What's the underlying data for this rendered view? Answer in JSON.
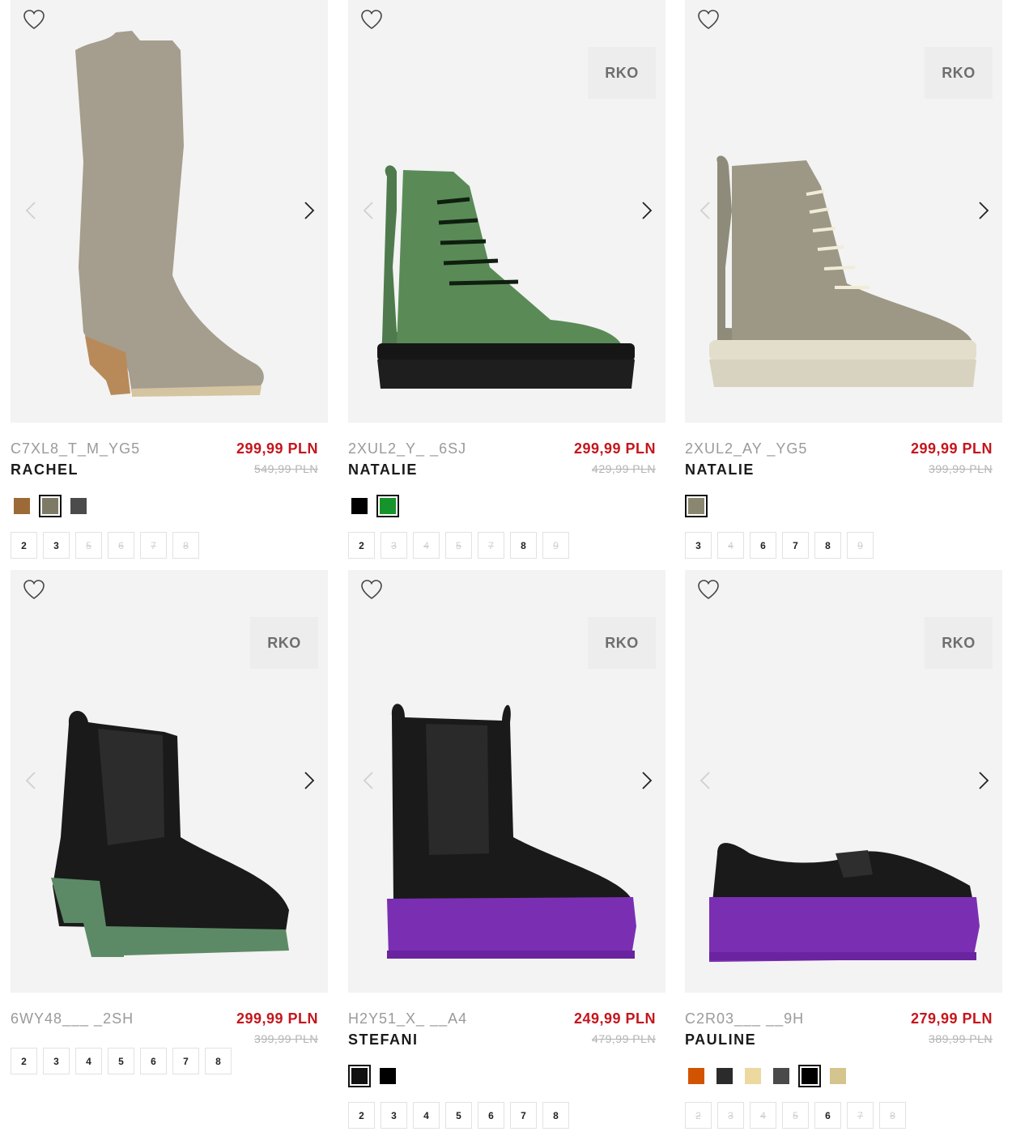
{
  "colors": {
    "price_red": "#c4161c",
    "text_dark": "#1a1a1a",
    "muted": "#9a9a9a",
    "tile_bg": "#f3f3f3"
  },
  "icons": {
    "wishlist": "heart-outline-icon",
    "prev": "chevron-left-icon",
    "next": "chevron-right-icon"
  },
  "products": [
    {
      "sku": "C7XL8_T_M_YG5",
      "name": "RACHEL",
      "price": "299,99 PLN",
      "old_price": "549,99 PLN",
      "brand": "",
      "swatches": [
        {
          "color": "#9c6a36",
          "selected": false
        },
        {
          "color": "#7d7a66",
          "selected": true
        },
        {
          "color": "#4b4b4b",
          "selected": false
        }
      ],
      "sizes": [
        {
          "label": "2",
          "available": true
        },
        {
          "label": "3",
          "available": true
        },
        {
          "label": "5",
          "available": false
        },
        {
          "label": "6",
          "available": false
        },
        {
          "label": "7",
          "available": false
        },
        {
          "label": "8",
          "available": false
        }
      ]
    },
    {
      "sku": "2XUL2_Y_ _6SJ",
      "name": "NATALIE",
      "price": "299,99 PLN",
      "old_price": "429,99 PLN",
      "brand": "RKO",
      "swatches": [
        {
          "color": "#000000",
          "selected": false
        },
        {
          "color": "#16932a",
          "selected": true
        }
      ],
      "sizes": [
        {
          "label": "2",
          "available": true
        },
        {
          "label": "3",
          "available": false
        },
        {
          "label": "4",
          "available": false
        },
        {
          "label": "5",
          "available": false
        },
        {
          "label": "7",
          "available": false
        },
        {
          "label": "8",
          "available": true
        },
        {
          "label": "9",
          "available": false
        }
      ]
    },
    {
      "sku": "2XUL2_AY _YG5",
      "name": "NATALIE",
      "price": "299,99 PLN",
      "old_price": "399,99 PLN",
      "brand": "RKO",
      "swatches": [
        {
          "color": "#8a8670",
          "selected": true
        }
      ],
      "sizes": [
        {
          "label": "3",
          "available": true
        },
        {
          "label": "4",
          "available": false
        },
        {
          "label": "6",
          "available": true
        },
        {
          "label": "7",
          "available": true
        },
        {
          "label": "8",
          "available": true
        },
        {
          "label": "9",
          "available": false
        }
      ]
    },
    {
      "sku": "6WY48___ _2SH",
      "name": "",
      "price": "299,99 PLN",
      "old_price": "399,99 PLN",
      "brand": "RKO",
      "swatches": [],
      "sizes": [
        {
          "label": "2",
          "available": true
        },
        {
          "label": "3",
          "available": true
        },
        {
          "label": "4",
          "available": true
        },
        {
          "label": "5",
          "available": true
        },
        {
          "label": "6",
          "available": true
        },
        {
          "label": "7",
          "available": true
        },
        {
          "label": "8",
          "available": true
        }
      ]
    },
    {
      "sku": "H2Y51_X_ __A4",
      "name": "STEFANI",
      "price": "249,99 PLN",
      "old_price": "479,99 PLN",
      "brand": "RKO",
      "swatches": [
        {
          "color": "#111111",
          "selected": true
        },
        {
          "color": "#000000",
          "selected": false
        }
      ],
      "sizes": [
        {
          "label": "2",
          "available": true
        },
        {
          "label": "3",
          "available": true
        },
        {
          "label": "4",
          "available": true
        },
        {
          "label": "5",
          "available": true
        },
        {
          "label": "6",
          "available": true
        },
        {
          "label": "7",
          "available": true
        },
        {
          "label": "8",
          "available": true
        }
      ]
    },
    {
      "sku": "C2R03___ __9H",
      "name": "PAULINE",
      "price": "279,99 PLN",
      "old_price": "389,99 PLN",
      "brand": "RKO",
      "swatches": [
        {
          "color": "#d35400",
          "selected": false
        },
        {
          "color": "#2b2b2b",
          "selected": false
        },
        {
          "color": "#ecd9a0",
          "selected": false
        },
        {
          "color": "#4a4a4a",
          "selected": false
        },
        {
          "color": "#000000",
          "selected": true
        },
        {
          "color": "#d4c48e",
          "selected": false
        }
      ],
      "sizes": [
        {
          "label": "2",
          "available": false
        },
        {
          "label": "3",
          "available": false
        },
        {
          "label": "4",
          "available": false
        },
        {
          "label": "5",
          "available": false
        },
        {
          "label": "6",
          "available": true
        },
        {
          "label": "7",
          "available": false
        },
        {
          "label": "8",
          "available": false
        }
      ]
    }
  ]
}
